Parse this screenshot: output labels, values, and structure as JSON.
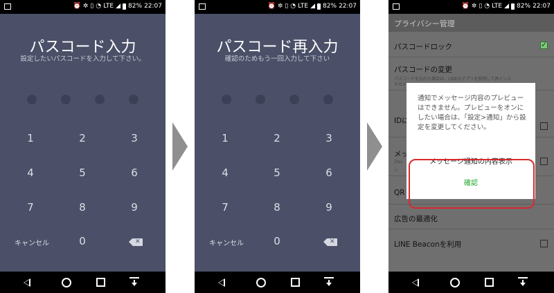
{
  "status_bar": {
    "battery": "82%",
    "time": "22:07",
    "network": "LTE"
  },
  "screen1": {
    "title": "パスコード入力",
    "subtitle": "設定したいパスコードを入力して下さい。",
    "keys": [
      "1",
      "2",
      "3",
      "4",
      "5",
      "6",
      "7",
      "8",
      "9"
    ],
    "cancel": "キャンセル",
    "zero": "0"
  },
  "screen2": {
    "title": "パスコード再入力",
    "subtitle": "確認のためもう一回入力して下さい",
    "keys": [
      "1",
      "2",
      "3",
      "4",
      "5",
      "6",
      "7",
      "8",
      "9"
    ],
    "cancel": "キャンセル",
    "zero": "0"
  },
  "screen3": {
    "header": "プライバシー管理",
    "passcode_lock": "パスコードロック",
    "passcode_change": "パスコードの変更",
    "passcode_change_desc_1": "パスコードを忘れた場合は、LINEのアプリを削除して再インス",
    "passcode_change_desc_2": "そのデ",
    "row_id": "IDに",
    "row_message": "メッ",
    "row_message_sub_1": "Zoic",
    "row_message_sub_2": "し",
    "row_qr": "QR",
    "ad_optimization": "広告の最適化",
    "line_beacon": "LINE Beaconを利用",
    "dialog": {
      "message": "通知でメッセージ内容のプレビューはできません。プレビューをオンにしたい場合は、「設定>通知」から設定を変更してください。",
      "item": "メッセージ通知の内容表示",
      "confirm": "確認"
    }
  },
  "colors": {
    "passcode_bg": "#4b5068",
    "highlight": "#d9292c",
    "confirm_green": "#22a62f"
  }
}
